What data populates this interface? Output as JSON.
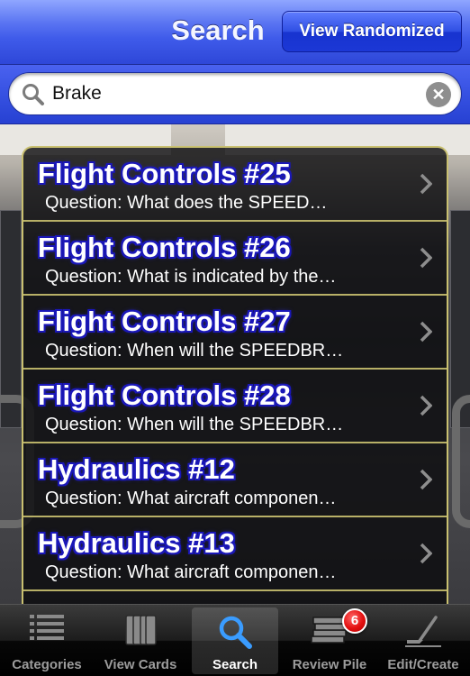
{
  "nav": {
    "title": "Search",
    "view_randomized_label": "View Randomized"
  },
  "search": {
    "value": "Brake",
    "placeholder": ""
  },
  "results": [
    {
      "title": "Flight Controls #25",
      "subtitle": "Question: What does the SPEED…"
    },
    {
      "title": "Flight Controls #26",
      "subtitle": "Question: What is indicated by the…"
    },
    {
      "title": "Flight Controls #27",
      "subtitle": "Question: When will the SPEEDBR…"
    },
    {
      "title": "Flight Controls #28",
      "subtitle": "Question: When will the SPEEDBR…"
    },
    {
      "title": "Hydraulics #12",
      "subtitle": "Question: What aircraft componen…"
    },
    {
      "title": "Hydraulics #13",
      "subtitle": "Question: What aircraft componen…"
    }
  ],
  "tabbar": {
    "tabs": [
      {
        "label": "Categories",
        "icon": "list-icon",
        "selected": false
      },
      {
        "label": "View Cards",
        "icon": "cards-icon",
        "selected": false
      },
      {
        "label": "Search",
        "icon": "search-icon",
        "selected": true
      },
      {
        "label": "Review Pile",
        "icon": "stack-icon",
        "selected": false,
        "badge": "6"
      },
      {
        "label": "Edit/Create",
        "icon": "pen-icon",
        "selected": false
      }
    ]
  },
  "colors": {
    "nav_blue": "#3f5bea",
    "title_outline": "#1a17b8",
    "row_divider": "#b8b067",
    "badge_red": "#e41010"
  }
}
